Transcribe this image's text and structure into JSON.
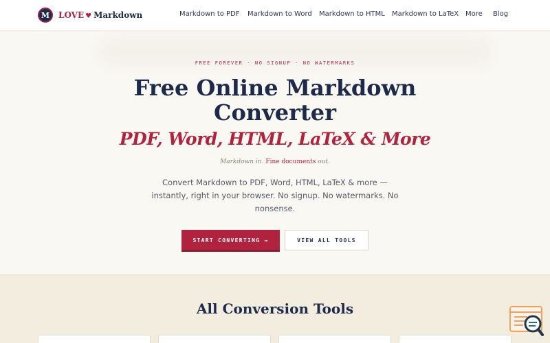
{
  "header": {
    "logo": {
      "badge_letter": "M",
      "brand_love": "LOVE",
      "brand_heart": "♥",
      "brand_name": "Markdown"
    },
    "nav": [
      {
        "label": "Markdown to PDF"
      },
      {
        "label": "Markdown to Word"
      },
      {
        "label": "Markdown to HTML"
      },
      {
        "label": "Markdown to LaTeX"
      },
      {
        "label": "More"
      },
      {
        "label": "Blog"
      }
    ]
  },
  "hero": {
    "eyebrow": "FREE FOREVER · NO SIGNUP · NO WATERMARKS",
    "title": "Free Online Markdown Converter",
    "subtitle": "PDF, Word, HTML, LaTeX & More",
    "tagline": {
      "part1": "Markdown in.",
      "highlight": "Fine documents",
      "part2": "out."
    },
    "description": "Convert Markdown to PDF, Word, HTML, LaTeX & more — instantly, right in your browser. No signup. No watermarks. No nonsense.",
    "primary_button": "START CONVERTING →",
    "secondary_button": "VIEW ALL TOOLS"
  },
  "tools": {
    "heading": "All Conversion Tools"
  },
  "widget": {
    "icon": "search-document-icon"
  },
  "colors": {
    "accent": "#b0223d",
    "navy": "#1e2a4a",
    "background": "#faf8f3",
    "section_background": "#f3ede0",
    "widget_orange": "#f0a060"
  }
}
